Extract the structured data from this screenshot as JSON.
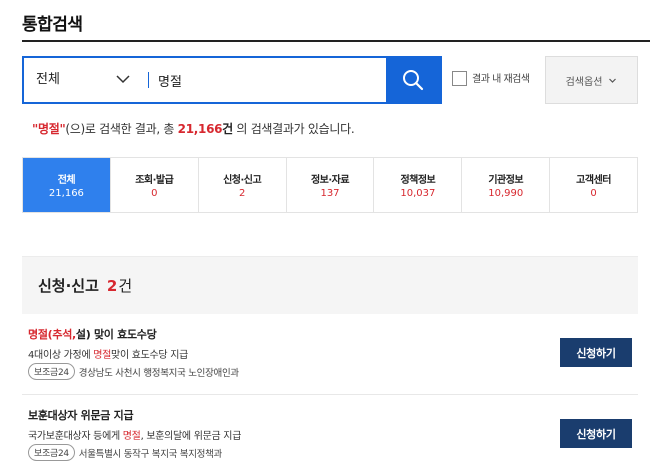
{
  "page": {
    "title": "통합검색"
  },
  "search": {
    "scope": "전체",
    "query": "명절",
    "within_label": "결과 내 재검색",
    "options_label": "검색옵션"
  },
  "summary": {
    "quote_open": "\"",
    "keyword": "명절",
    "quote_close": "\"",
    "part1": "(으)로 검색한 결과, 총 ",
    "total": "21,166",
    "unit": "건",
    "part2": " 의 검색결과가 있습니다."
  },
  "tabs": [
    {
      "label": "전체",
      "count": "21,166",
      "active": true
    },
    {
      "label": "조회·발급",
      "count": "0"
    },
    {
      "label": "신청·신고",
      "count": "2"
    },
    {
      "label": "정보·자료",
      "count": "137"
    },
    {
      "label": "정책정보",
      "count": "10,037"
    },
    {
      "label": "기관정보",
      "count": "10,990"
    },
    {
      "label": "고객센터",
      "count": "0"
    }
  ],
  "section": {
    "title": "신청·신고",
    "count": "2",
    "unit": "건",
    "items": [
      {
        "title_kw": "명절",
        "title_kw2": "(추석,",
        "title_rest": "설) 맞이 효도수당",
        "desc_pre": "4대이상 가정에 ",
        "desc_kw": "명절",
        "desc_post": "맞이 효도수당 지급",
        "badge": "보조금24",
        "org": "경상남도 사천시 행정복지국 노인장애인과",
        "button": "신청하기"
      },
      {
        "title": "보훈대상자 위문금 지급",
        "desc_pre": "국가보훈대상자 등에게 ",
        "desc_kw": "명절",
        "desc_post": ", 보훈의달에 위문금 지급",
        "badge": "보조금24",
        "org": "서울특별시 동작구 복지국 복지정책과",
        "button": "신청하기"
      }
    ]
  },
  "colors": {
    "primary": "#1565d8",
    "tab_active": "#2f80ed",
    "highlight": "#d7282f",
    "button_dark": "#1a3d6e"
  }
}
